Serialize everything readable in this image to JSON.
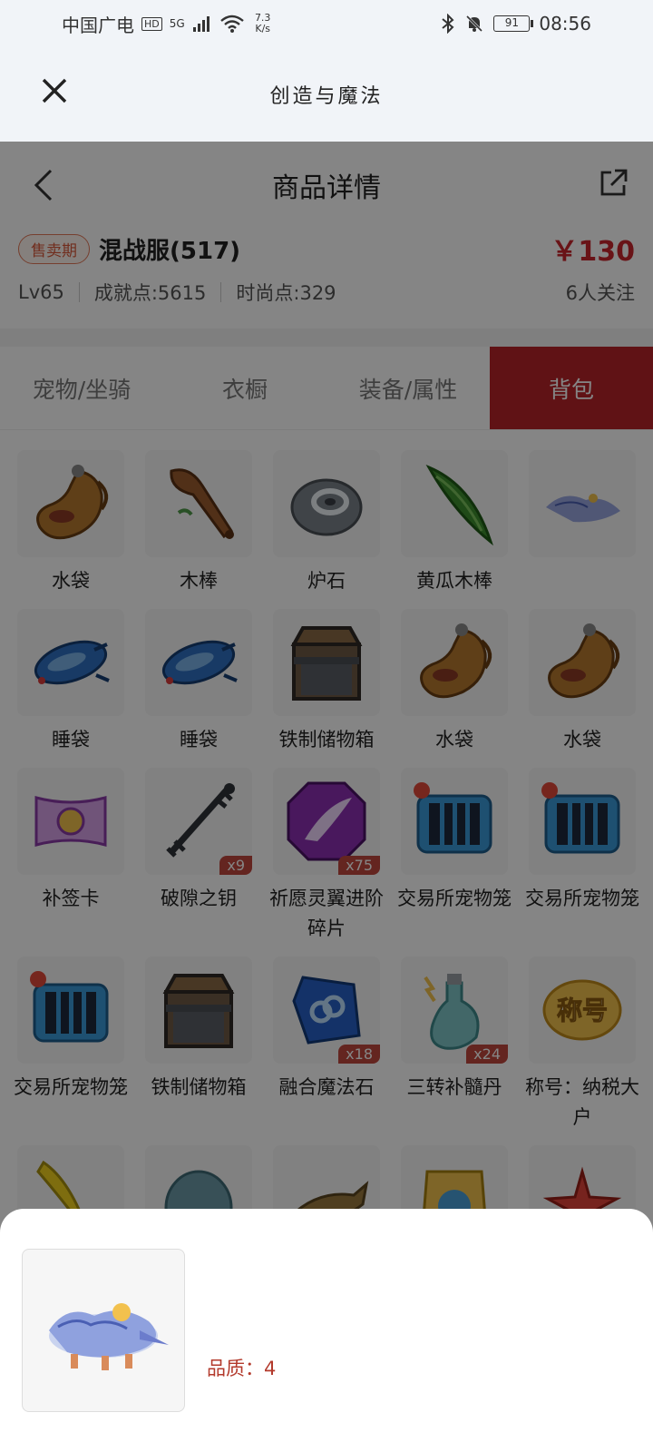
{
  "status_bar": {
    "carrier": "中国广电",
    "hd": "HD",
    "network": "5G",
    "speed_top": "7.3",
    "speed_bottom": "K/s",
    "battery": "91",
    "time": "08:56"
  },
  "mini_program": {
    "title": "创造与魔法"
  },
  "nav": {
    "title": "商品详情"
  },
  "product": {
    "status_tag": "售卖期",
    "server": "混战服(517)",
    "price": "￥130",
    "level": "Lv65",
    "achievement": "成就点:5615",
    "fashion": "时尚点:329",
    "followers": "6人关注"
  },
  "tabs": [
    {
      "label": "宠物/坐骑",
      "active": false
    },
    {
      "label": "衣橱",
      "active": false
    },
    {
      "label": "装备/属性",
      "active": false
    },
    {
      "label": "背包",
      "active": true
    }
  ],
  "items": [
    {
      "name": "水袋",
      "icon": "water-bag-icon",
      "qty": ""
    },
    {
      "name": "木棒",
      "icon": "wooden-club-icon",
      "qty": ""
    },
    {
      "name": "炉石",
      "icon": "hearthstone-icon",
      "qty": ""
    },
    {
      "name": "黄瓜木棒",
      "icon": "cucumber-club-icon",
      "qty": ""
    },
    {
      "name": "",
      "icon": "white-tiger-mount-icon",
      "qty": ""
    },
    {
      "name": "睡袋",
      "icon": "sleeping-bag-icon",
      "qty": ""
    },
    {
      "name": "睡袋",
      "icon": "sleeping-bag-icon",
      "qty": ""
    },
    {
      "name": "铁制储物箱",
      "icon": "iron-chest-icon",
      "qty": ""
    },
    {
      "name": "水袋",
      "icon": "water-bag-icon",
      "qty": ""
    },
    {
      "name": "水袋",
      "icon": "water-bag-icon",
      "qty": ""
    },
    {
      "name": "补签卡",
      "icon": "sign-card-icon",
      "qty": ""
    },
    {
      "name": "破隙之钥",
      "icon": "rift-key-icon",
      "qty": "x9"
    },
    {
      "name": "祈愿灵翼进阶碎片",
      "icon": "wing-fragment-icon",
      "qty": "x75"
    },
    {
      "name": "交易所宠物笼",
      "icon": "pet-cage-icon",
      "qty": ""
    },
    {
      "name": "交易所宠物笼",
      "icon": "pet-cage-icon",
      "qty": ""
    },
    {
      "name": "交易所宠物笼",
      "icon": "pet-cage-icon",
      "qty": ""
    },
    {
      "name": "铁制储物箱",
      "icon": "iron-chest-icon",
      "qty": ""
    },
    {
      "name": "融合魔法石",
      "icon": "fusion-stone-icon",
      "qty": "x18"
    },
    {
      "name": "三转补髓丹",
      "icon": "elixir-bottle-icon",
      "qty": "x24"
    },
    {
      "name": "称号：纳税大户",
      "icon": "title-badge-icon",
      "qty": ""
    },
    {
      "name": "",
      "icon": "banana-icon",
      "qty": ""
    },
    {
      "name": "",
      "icon": "egg-icon",
      "qty": ""
    },
    {
      "name": "",
      "icon": "fish-icon",
      "qty": ""
    },
    {
      "name": "",
      "icon": "feed-bag-icon",
      "qty": ""
    },
    {
      "name": "",
      "icon": "starfish-icon",
      "qty": ""
    }
  ],
  "badge_text": "称号",
  "sheet": {
    "quality": "品质：4"
  }
}
